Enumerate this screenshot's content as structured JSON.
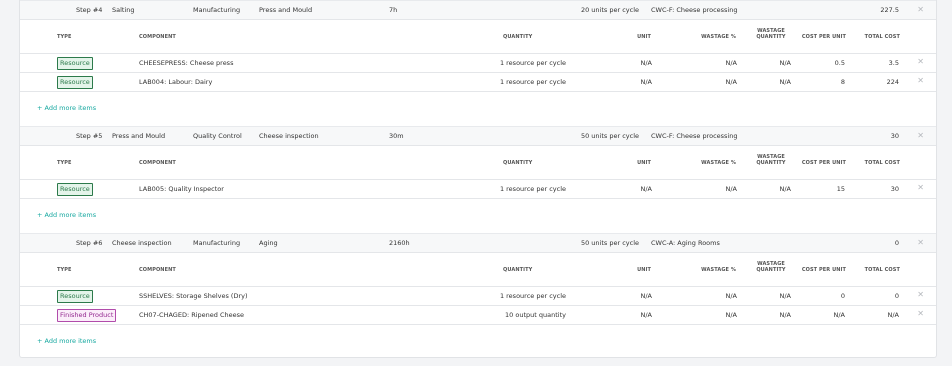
{
  "headers": {
    "type": "TYPE",
    "component": "COMPONENT",
    "quantity": "QUANTITY",
    "unit": "UNIT",
    "wastage_pct": "WASTAGE %",
    "wastage_qty": "WASTAGE QUANTITY",
    "cost_per_unit": "COST PER UNIT",
    "total_cost": "TOTAL COST"
  },
  "add_label": "+ Add more items",
  "close_glyph": "✕",
  "colors": {
    "accent": "#17a8a0",
    "resource_badge": "#2c7a4b",
    "finished_badge": "#93278f"
  },
  "steps": [
    {
      "step": "Step #4",
      "from": "Salting",
      "category": "Manufacturing",
      "to": "Press and Mould",
      "duration": "7h",
      "rate": "20 units per cycle",
      "workcenter": "CWC-F: Cheese processing",
      "cost": "227.5",
      "rows": [
        {
          "type": "Resource",
          "component": "CHEESEPRESS: Cheese press",
          "quantity": "1 resource per cycle",
          "unit": "N/A",
          "wastage_pct": "N/A",
          "wastage_qty": "N/A",
          "cost_per_unit": "0.5",
          "total_cost": "3.5"
        },
        {
          "type": "Resource",
          "component": "LAB004: Labour: Dairy",
          "quantity": "1 resource per cycle",
          "unit": "N/A",
          "wastage_pct": "N/A",
          "wastage_qty": "N/A",
          "cost_per_unit": "8",
          "total_cost": "224"
        }
      ]
    },
    {
      "step": "Step #5",
      "from": "Press and Mould",
      "category": "Quality Control",
      "to": "Cheese inspection",
      "duration": "30m",
      "rate": "50 units per cycle",
      "workcenter": "CWC-F: Cheese processing",
      "cost": "30",
      "rows": [
        {
          "type": "Resource",
          "component": "LAB005: Quality Inspector",
          "quantity": "1 resource per cycle",
          "unit": "N/A",
          "wastage_pct": "N/A",
          "wastage_qty": "N/A",
          "cost_per_unit": "15",
          "total_cost": "30"
        }
      ]
    },
    {
      "step": "Step #6",
      "from": "Cheese inspection",
      "category": "Manufacturing",
      "to": "Aging",
      "duration": "2160h",
      "rate": "50 units per cycle",
      "workcenter": "CWC-A: Aging Rooms",
      "cost": "0",
      "rows": [
        {
          "type": "Resource",
          "component": "SSHELVES: Storage Shelves (Dry)",
          "quantity": "1 resource per cycle",
          "unit": "N/A",
          "wastage_pct": "N/A",
          "wastage_qty": "N/A",
          "cost_per_unit": "0",
          "total_cost": "0"
        },
        {
          "type": "Finished Product",
          "component": "CH07-CHAGED: Ripened Cheese",
          "quantity": "10 output quantity",
          "unit": "N/A",
          "wastage_pct": "N/A",
          "wastage_qty": "N/A",
          "cost_per_unit": "N/A",
          "total_cost": "N/A"
        }
      ]
    }
  ]
}
